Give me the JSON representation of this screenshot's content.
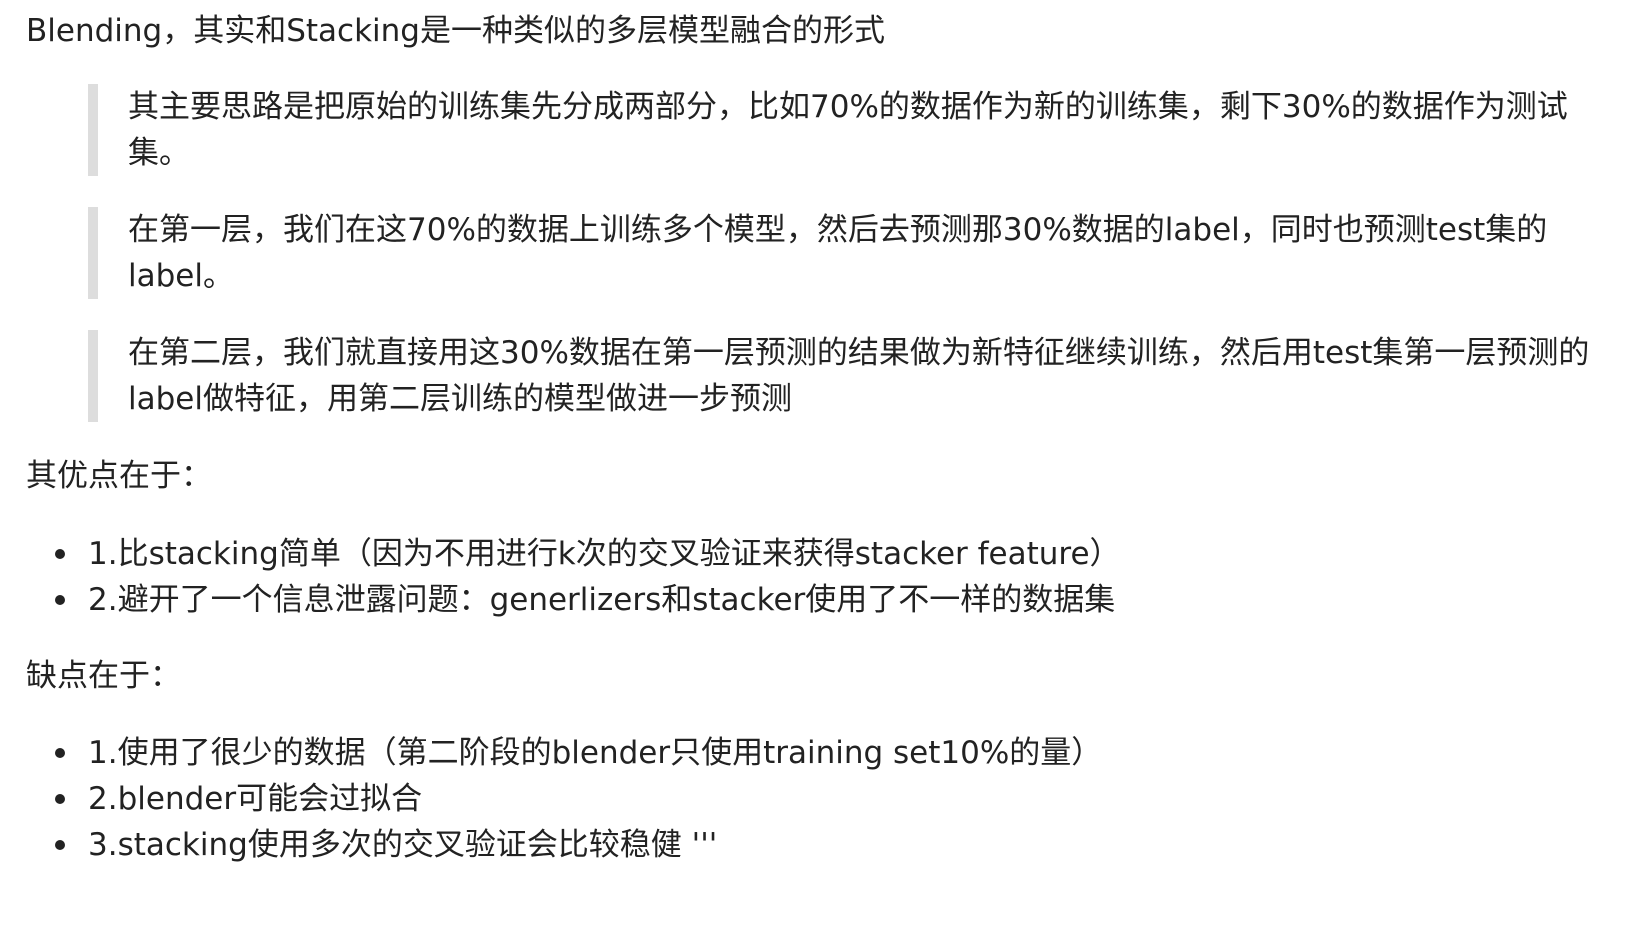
{
  "intro": "Blending，其实和Stacking是一种类似的多层模型融合的形式",
  "quotes": [
    "其主要思路是把原始的训练集先分成两部分，比如70%的数据作为新的训练集，剩下30%的数据作为测试集。",
    "在第一层，我们在这70%的数据上训练多个模型，然后去预测那30%数据的label，同时也预测test集的label。",
    "在第二层，我们就直接用这30%数据在第一层预测的结果做为新特征继续训练，然后用test集第一层预测的label做特征，用第二层训练的模型做进一步预测"
  ],
  "advantages": {
    "heading": "其优点在于：",
    "items": [
      "1.比stacking简单（因为不用进行k次的交叉验证来获得stacker feature）",
      "2.避开了一个信息泄露问题：generlizers和stacker使用了不一样的数据集"
    ]
  },
  "disadvantages": {
    "heading": "缺点在于：",
    "items": [
      "1.使用了很少的数据（第二阶段的blender只使用training set10%的量）",
      "2.blender可能会过拟合",
      "3.stacking使用多次的交叉验证会比较稳健 '''"
    ]
  }
}
